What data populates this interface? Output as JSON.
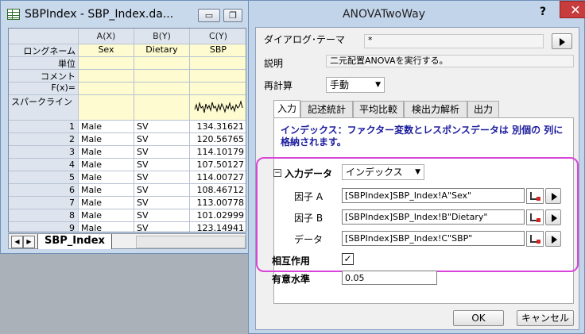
{
  "worksheet": {
    "title": "SBPIndex - SBP_Index.da...",
    "buttons": {
      "minimize": "▭",
      "restore": "❐"
    },
    "columns": [
      {
        "header": "A(X)",
        "longname": "Sex"
      },
      {
        "header": "B(Y)",
        "longname": "Dietary"
      },
      {
        "header": "C(Y)",
        "longname": "SBP"
      }
    ],
    "row_labels": {
      "longname": "ロングネーム",
      "units": "単位",
      "comments": "コメント",
      "fx": "F(x)=",
      "sparklines": "スパークライン"
    },
    "rows": [
      {
        "num": "1",
        "a": "Male",
        "b": "SV",
        "c": "134.31621"
      },
      {
        "num": "2",
        "a": "Male",
        "b": "SV",
        "c": "120.56765"
      },
      {
        "num": "3",
        "a": "Male",
        "b": "SV",
        "c": "114.10179"
      },
      {
        "num": "4",
        "a": "Male",
        "b": "SV",
        "c": "107.50127"
      },
      {
        "num": "5",
        "a": "Male",
        "b": "SV",
        "c": "114.00727"
      },
      {
        "num": "6",
        "a": "Male",
        "b": "SV",
        "c": "108.46712"
      },
      {
        "num": "7",
        "a": "Male",
        "b": "SV",
        "c": "113.00778"
      },
      {
        "num": "8",
        "a": "Male",
        "b": "SV",
        "c": "101.02999"
      },
      {
        "num": "9",
        "a": "Male",
        "b": "SV",
        "c": "123.14941"
      }
    ],
    "sheet_tab": "SBP_Index"
  },
  "dialog": {
    "title": "ANOVATwoWay",
    "help": "?",
    "close": "✕",
    "theme_label": "ダイアログ･テーマ",
    "theme_value": "*",
    "description_label": "説明",
    "description_value": "二元配置ANOVAを実行する。",
    "recalc_label": "再計算",
    "recalc_value": "手動",
    "tabs": [
      "入力",
      "記述統計",
      "平均比較",
      "検出力解析",
      "出力"
    ],
    "panel_description": "インデックス：ファクター変数とレスポンスデータは 別個の 列に格納されます。",
    "input_data_label": "入力データ",
    "input_data_value": "インデックス",
    "factor_a_label": "因子 A",
    "factor_a_value": "[SBPIndex]SBP_Index!A\"Sex\"",
    "factor_b_label": "因子 B",
    "factor_b_value": "[SBPIndex]SBP_Index!B\"Dietary\"",
    "data_label": "データ",
    "data_value": "[SBPIndex]SBP_Index!C\"SBP\"",
    "interaction_label": "相互作用",
    "interaction_checked": true,
    "interaction_mark": "✓",
    "significance_label": "有意水準",
    "significance_value": "0.05",
    "ok": "OK",
    "cancel": "キャンセル"
  },
  "colors": {
    "highlight": "#d945d9",
    "description_text": "#1d1d9e",
    "label_rows_bg": "#fdfbcf",
    "close_button": "#c73c3c"
  }
}
